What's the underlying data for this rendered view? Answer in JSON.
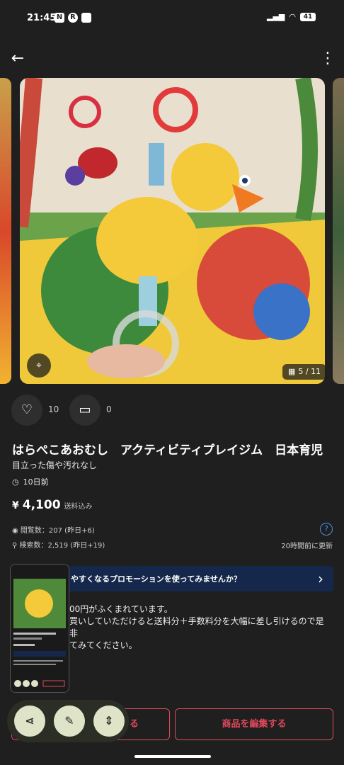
{
  "status_bar": {
    "time": "21:45",
    "battery": "41",
    "app_icons": [
      "N",
      "R"
    ]
  },
  "header": {
    "back_icon": "arrow-left-icon",
    "menu_icon": "more-vertical-icon"
  },
  "gallery": {
    "counter": "5 / 11"
  },
  "reactions": {
    "likes": "10",
    "comments": "0"
  },
  "item": {
    "title": "はらぺこあおむし　アクティビティプレイジム　日本育児",
    "condition": "目立った傷や汚れなし",
    "posted": "10日前",
    "price_symbol": "¥",
    "price": "4,100",
    "shipping": "送料込み"
  },
  "stats": {
    "views": "閲覧数：207 (昨日+6)",
    "searches": "検索数：2,519 (昨日+19)",
    "updated": "20時間前に更新"
  },
  "promo": {
    "banner": "やすくなるプロモーションを使ってみませんか？",
    "line1": "00円がふくまれています。",
    "line2": "買いしていただけると送料分＋手数料分を大幅に差し引けるので是非",
    "line3": "てみてください。"
  },
  "buttons": {
    "left_label": "る",
    "edit_label": "商品を編集する"
  },
  "colors": {
    "accent": "#e0495c",
    "promo_bg": "#15284b",
    "fab_bg": "#dfe3c8"
  }
}
